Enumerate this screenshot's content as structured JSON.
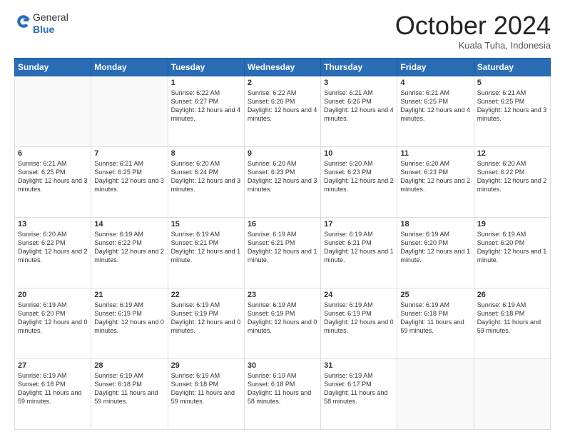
{
  "header": {
    "logo_general": "General",
    "logo_blue": "Blue",
    "month_title": "October 2024",
    "location": "Kuala Tuha, Indonesia"
  },
  "days_of_week": [
    "Sunday",
    "Monday",
    "Tuesday",
    "Wednesday",
    "Thursday",
    "Friday",
    "Saturday"
  ],
  "weeks": [
    [
      {
        "day": "",
        "info": ""
      },
      {
        "day": "",
        "info": ""
      },
      {
        "day": "1",
        "info": "Sunrise: 6:22 AM\nSunset: 6:27 PM\nDaylight: 12 hours and 4 minutes."
      },
      {
        "day": "2",
        "info": "Sunrise: 6:22 AM\nSunset: 6:26 PM\nDaylight: 12 hours and 4 minutes."
      },
      {
        "day": "3",
        "info": "Sunrise: 6:21 AM\nSunset: 6:26 PM\nDaylight: 12 hours and 4 minutes."
      },
      {
        "day": "4",
        "info": "Sunrise: 6:21 AM\nSunset: 6:25 PM\nDaylight: 12 hours and 4 minutes."
      },
      {
        "day": "5",
        "info": "Sunrise: 6:21 AM\nSunset: 6:25 PM\nDaylight: 12 hours and 3 minutes."
      }
    ],
    [
      {
        "day": "6",
        "info": "Sunrise: 6:21 AM\nSunset: 6:25 PM\nDaylight: 12 hours and 3 minutes."
      },
      {
        "day": "7",
        "info": "Sunrise: 6:21 AM\nSunset: 6:25 PM\nDaylight: 12 hours and 3 minutes."
      },
      {
        "day": "8",
        "info": "Sunrise: 6:20 AM\nSunset: 6:24 PM\nDaylight: 12 hours and 3 minutes."
      },
      {
        "day": "9",
        "info": "Sunrise: 6:20 AM\nSunset: 6:23 PM\nDaylight: 12 hours and 3 minutes."
      },
      {
        "day": "10",
        "info": "Sunrise: 6:20 AM\nSunset: 6:23 PM\nDaylight: 12 hours and 2 minutes."
      },
      {
        "day": "11",
        "info": "Sunrise: 6:20 AM\nSunset: 6:23 PM\nDaylight: 12 hours and 2 minutes."
      },
      {
        "day": "12",
        "info": "Sunrise: 6:20 AM\nSunset: 6:22 PM\nDaylight: 12 hours and 2 minutes."
      }
    ],
    [
      {
        "day": "13",
        "info": "Sunrise: 6:20 AM\nSunset: 6:22 PM\nDaylight: 12 hours and 2 minutes."
      },
      {
        "day": "14",
        "info": "Sunrise: 6:19 AM\nSunset: 6:22 PM\nDaylight: 12 hours and 2 minutes."
      },
      {
        "day": "15",
        "info": "Sunrise: 6:19 AM\nSunset: 6:21 PM\nDaylight: 12 hours and 1 minute."
      },
      {
        "day": "16",
        "info": "Sunrise: 6:19 AM\nSunset: 6:21 PM\nDaylight: 12 hours and 1 minute."
      },
      {
        "day": "17",
        "info": "Sunrise: 6:19 AM\nSunset: 6:21 PM\nDaylight: 12 hours and 1 minute."
      },
      {
        "day": "18",
        "info": "Sunrise: 6:19 AM\nSunset: 6:20 PM\nDaylight: 12 hours and 1 minute."
      },
      {
        "day": "19",
        "info": "Sunrise: 6:19 AM\nSunset: 6:20 PM\nDaylight: 12 hours and 1 minute."
      }
    ],
    [
      {
        "day": "20",
        "info": "Sunrise: 6:19 AM\nSunset: 6:20 PM\nDaylight: 12 hours and 0 minutes."
      },
      {
        "day": "21",
        "info": "Sunrise: 6:19 AM\nSunset: 6:19 PM\nDaylight: 12 hours and 0 minutes."
      },
      {
        "day": "22",
        "info": "Sunrise: 6:19 AM\nSunset: 6:19 PM\nDaylight: 12 hours and 0 minutes."
      },
      {
        "day": "23",
        "info": "Sunrise: 6:19 AM\nSunset: 6:19 PM\nDaylight: 12 hours and 0 minutes."
      },
      {
        "day": "24",
        "info": "Sunrise: 6:19 AM\nSunset: 6:19 PM\nDaylight: 12 hours and 0 minutes."
      },
      {
        "day": "25",
        "info": "Sunrise: 6:19 AM\nSunset: 6:18 PM\nDaylight: 11 hours and 59 minutes."
      },
      {
        "day": "26",
        "info": "Sunrise: 6:19 AM\nSunset: 6:18 PM\nDaylight: 11 hours and 59 minutes."
      }
    ],
    [
      {
        "day": "27",
        "info": "Sunrise: 6:19 AM\nSunset: 6:18 PM\nDaylight: 11 hours and 59 minutes."
      },
      {
        "day": "28",
        "info": "Sunrise: 6:19 AM\nSunset: 6:18 PM\nDaylight: 11 hours and 59 minutes."
      },
      {
        "day": "29",
        "info": "Sunrise: 6:19 AM\nSunset: 6:18 PM\nDaylight: 11 hours and 59 minutes."
      },
      {
        "day": "30",
        "info": "Sunrise: 6:19 AM\nSunset: 6:18 PM\nDaylight: 11 hours and 58 minutes."
      },
      {
        "day": "31",
        "info": "Sunrise: 6:19 AM\nSunset: 6:17 PM\nDaylight: 11 hours and 58 minutes."
      },
      {
        "day": "",
        "info": ""
      },
      {
        "day": "",
        "info": ""
      }
    ]
  ]
}
